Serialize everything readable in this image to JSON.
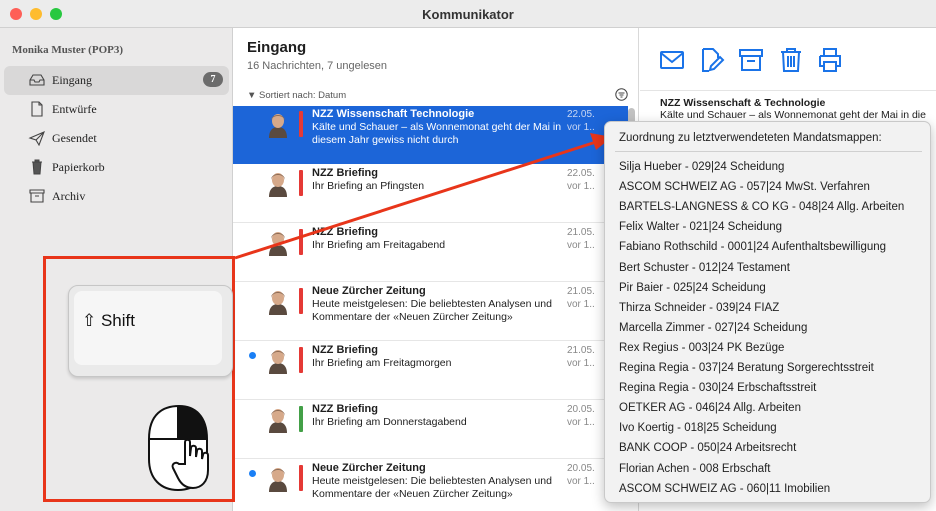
{
  "window": {
    "title": "Kommunikator"
  },
  "sidebar": {
    "account": "Monika Muster (POP3)",
    "items": [
      {
        "label": "Eingang",
        "badge": "7",
        "icon": "inbox-icon"
      },
      {
        "label": "Entwürfe",
        "icon": "draft-icon"
      },
      {
        "label": "Gesendet",
        "icon": "sent-icon"
      },
      {
        "label": "Papierkorb",
        "icon": "trash-icon"
      },
      {
        "label": "Archiv",
        "icon": "archive-icon"
      }
    ]
  },
  "list": {
    "title": "Eingang",
    "subtitle": "16 Nachrichten, 7 ungelesen",
    "sort_label": "Sortiert nach: Datum",
    "messages": [
      {
        "sender": "NZZ Wissenschaft  Technologie",
        "subject": "Kälte und Schauer – als Wonnemonat geht der Mai in diesem Jahr gewiss nicht durch",
        "date": "22.05.21",
        "ago": "vor 1...",
        "flag": "#e53935",
        "unread": false
      },
      {
        "sender": "NZZ Briefing",
        "subject": "Ihr Briefing an Pfingsten",
        "date": "22.05.2",
        "ago": "vor 1...",
        "flag": "#e53935",
        "unread": false
      },
      {
        "sender": "NZZ Briefing",
        "subject": "Ihr Briefing am Freitagabend",
        "date": "21.05.2",
        "ago": "vor 1...3",
        "flag": "#e53935",
        "unread": false
      },
      {
        "sender": "Neue Zürcher Zeitung",
        "subject": "Heute meistgelesen: Die beliebtesten Analysen und Kommentare der «Neuen Zürcher Zeitung»",
        "date": "21.05.2",
        "ago": "vor 1...3",
        "flag": "#e53935",
        "unread": false
      },
      {
        "sender": "NZZ Briefing",
        "subject": "Ihr Briefing am Freitagmorgen",
        "date": "21.05.2",
        "ago": "vor 1...3",
        "flag": "#e53935",
        "unread": true
      },
      {
        "sender": "NZZ Briefing",
        "subject": "Ihr Briefing am Donnerstagabend",
        "date": "20.05.2",
        "ago": "vor 1...4",
        "flag": "#43a047",
        "unread": false
      },
      {
        "sender": "Neue Zürcher Zeitung",
        "subject": "Heute meistgelesen: Die beliebtesten Analysen und Kommentare der «Neuen Zürcher Zeitung»",
        "date": "20.05.2",
        "ago": "vor 1...4",
        "flag": "#e53935",
        "unread": true
      }
    ]
  },
  "reading": {
    "toolbar": [
      "mail-icon",
      "compose-icon",
      "archive-icon",
      "trash-icon",
      "print-icon"
    ],
    "sender": "NZZ Wissenschaft & Technologie",
    "preview": "Kälte und Schauer – als Wonnemonat geht der Mai in die"
  },
  "overlay": {
    "shift_label": "⇧ Shift"
  },
  "popup": {
    "header": "Zuordnung zu letztverwendeteten Mandatsmappen:",
    "items": [
      "Silja Hueber - 029|24 Scheidung",
      "ASCOM SCHWEIZ AG - 057|24 MwSt. Verfahren",
      "BARTELS-LANGNESS & CO KG - 048|24 Allg. Arbeiten",
      "Felix Walter - 021|24 Scheidung",
      "Fabiano Rothschild - 0001|24 Aufenthaltsbewilligung",
      "Bert Schuster - 012|24 Testament",
      "Pir Baier - 025|24 Scheidung",
      "Thirza Schneider - 039|24 FIAZ",
      "Marcella Zimmer - 027|24 Scheidung",
      "Rex Regius - 003|24 PK Bezüge",
      "Regina Regia - 037|24 Beratung Sorgerechtsstreit",
      "Regina Regia - 030|24 Erbschaftsstreit",
      "OETKER AG - 046|24 Allg. Arbeiten",
      "Ivo Koertig - 018|25 Scheidung",
      "BANK COOP - 050|24 Arbeitsrecht",
      "Florian Achen - 008 Erbschaft",
      "ASCOM SCHWEIZ AG - 060|11 Imobilien"
    ]
  },
  "colors": {
    "accent": "#1c65d8",
    "annotation": "#e8351a",
    "icon_blue": "#1a73e8"
  }
}
